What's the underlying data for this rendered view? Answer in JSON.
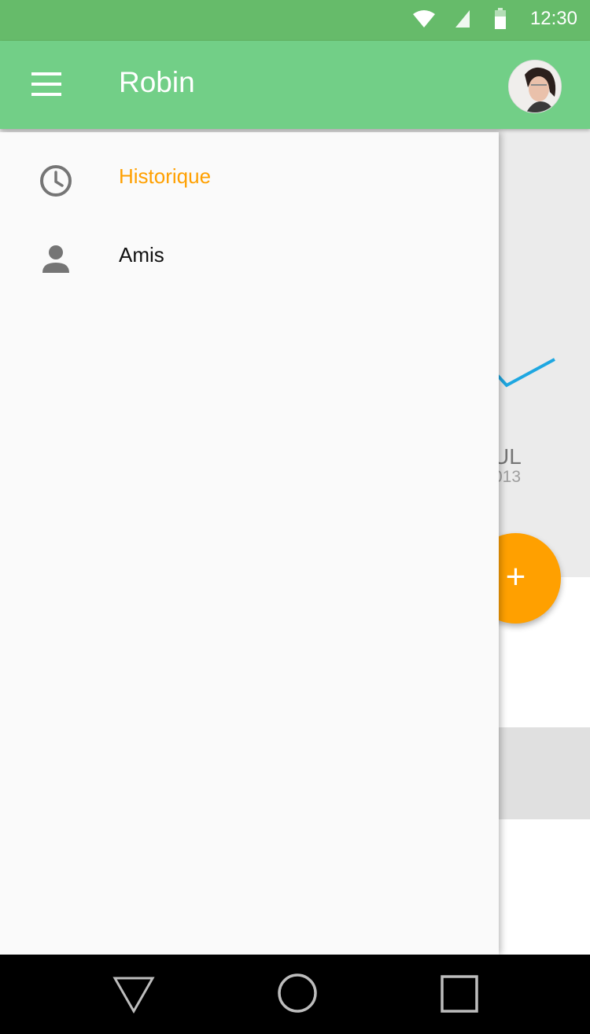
{
  "status_bar": {
    "time": "12:30",
    "icons": [
      "wifi-icon",
      "signal-icon",
      "battery-icon"
    ]
  },
  "app_bar": {
    "title": "Robin",
    "menu_icon": "hamburger-menu-icon",
    "avatar": "profile-avatar"
  },
  "drawer": {
    "items": [
      {
        "label": "Historique",
        "icon": "clock-icon",
        "active": true
      },
      {
        "label": "Amis",
        "icon": "person-icon",
        "active": false
      }
    ]
  },
  "background": {
    "chart_month_label": "UL",
    "chart_year_label": "013",
    "fab_icon": "+"
  },
  "nav_bar": {
    "icons": [
      "back-icon",
      "home-icon",
      "recents-icon"
    ]
  },
  "colors": {
    "status_bar": "#66bb6a",
    "app_bar": "#72cf87",
    "accent": "#ffa000",
    "chart_line": "#1ea7e1",
    "icon_gray": "#757575",
    "drawer_bg": "#fafafa",
    "nav_bar": "#000000"
  }
}
